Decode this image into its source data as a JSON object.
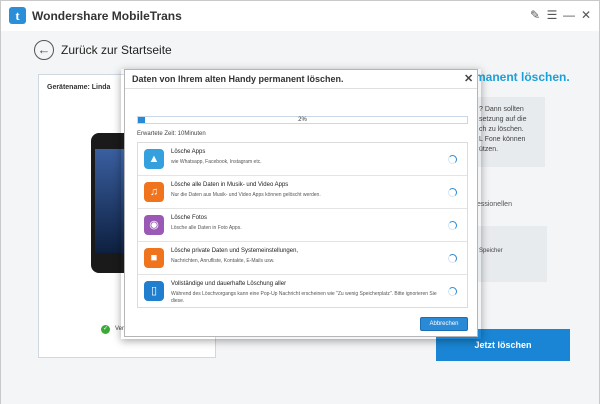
{
  "app": {
    "title": "Wondershare MobileTrans",
    "logo_letter": "t"
  },
  "titlebar_icons": [
    "feedback-icon",
    "menu-icon",
    "minimize-icon",
    "close-icon"
  ],
  "back": {
    "label": "Zurück zur Startseite"
  },
  "left_panel": {
    "device_label": "Gerätename: Linda",
    "status_text": "Ver"
  },
  "right_panel": {
    "heading": "manent löschen.",
    "card_text": "? Dann sollten\nsetzung auf die\nch zu löschen.\nL Fone können\nützen.",
    "sub_text": "fessionellen",
    "card2_text": "Speicher",
    "delete_button": "Jetzt löschen"
  },
  "dialog": {
    "title": "Daten von Ihrem alten Handy permanent löschen.",
    "progress": {
      "value": 2,
      "text": "2%"
    },
    "eta": "Erwartete Zeit: 10Minuten",
    "items": [
      {
        "title": "Lösche Apps",
        "desc": "wie Whatsapp, Facebook, Instagram etc.",
        "icon": "app-store-icon",
        "color": "#34a0dd"
      },
      {
        "title": "Lösche alle Daten in Musik- und Video Apps",
        "desc": "Nur die Daten aus Musik- und Video Apps können gelöscht werden.",
        "icon": "music-icon",
        "color": "#f0731e"
      },
      {
        "title": "Lösche Fotos",
        "desc": "Lösche alle Daten in Foto Apps.",
        "icon": "camera-icon",
        "color": "#9b59b6"
      },
      {
        "title": "Lösche private Daten und Systemeinstellungen,",
        "desc": "Nachrichten, Anrufliste, Kontakte, E-Mails usw.",
        "icon": "lock-icon",
        "color": "#f0731e"
      },
      {
        "title": "Vollständige und dauerhafte Löschung aller",
        "desc": "Während des Löschvorgangs kann eine Pop-Up Nachricht erscheinen wie \"Zu wenig Speicherplatz\". Bitte ignorieren Sie diese.",
        "icon": "phone-icon",
        "color": "#1f7fce"
      }
    ],
    "cancel_button": "Abbrechen"
  },
  "colors": {
    "accent": "#1ca0d8",
    "button": "#1a85d4",
    "progress": "#2b8ad6"
  }
}
